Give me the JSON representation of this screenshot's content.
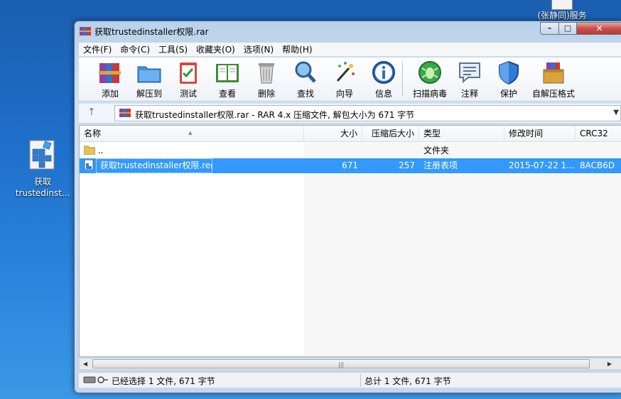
{
  "desktop": {
    "icon_label": "获取\ntrustedinst...",
    "icon_label_line1": "获取",
    "icon_label_line2": "trustedinst...",
    "top_right_label": "(张静同)服务"
  },
  "window": {
    "title": "获取trustedinstaller权限.rar",
    "controls": {
      "minimize": "–",
      "maximize": "□",
      "close": "✕"
    }
  },
  "menu": [
    "文件(F)",
    "命令(C)",
    "工具(S)",
    "收藏夹(O)",
    "选项(N)",
    "帮助(H)"
  ],
  "toolbar": [
    {
      "label": "添加",
      "icon": "books-icon"
    },
    {
      "label": "解压到",
      "icon": "folder-extract-icon"
    },
    {
      "label": "测试",
      "icon": "clipboard-check-icon"
    },
    {
      "label": "查看",
      "icon": "book-open-icon"
    },
    {
      "label": "删除",
      "icon": "trash-icon"
    },
    {
      "label": "查找",
      "icon": "magnifier-icon"
    },
    {
      "label": "向导",
      "icon": "wand-icon"
    },
    {
      "label": "信息",
      "icon": "info-icon"
    },
    {
      "label": "扫描病毒",
      "icon": "bug-icon"
    },
    {
      "label": "注释",
      "icon": "comment-icon"
    },
    {
      "label": "保护",
      "icon": "shield-icon"
    },
    {
      "label": "自解压格式",
      "icon": "sfx-box-icon"
    }
  ],
  "address": {
    "path": "获取trustedinstaller权限.rar - RAR 4.x 压缩文件, 解包大小为 671 字节"
  },
  "columns": [
    "名称",
    "大小",
    "压缩后大小",
    "类型",
    "修改时间",
    "CRC32"
  ],
  "files": [
    {
      "name": "..",
      "size": "",
      "packed": "",
      "type": "文件夹",
      "modified": "",
      "crc": "",
      "selected": false
    },
    {
      "name": "获取trustedinstaller权限.reg",
      "size": "671",
      "packed": "257",
      "type": "注册表项",
      "modified": "2015-07-22 1...",
      "crc": "8ACB6D",
      "selected": true
    }
  ],
  "status": {
    "left": "已经选择 1 文件, 671 字节",
    "right": "总计 1 文件, 671 字节"
  },
  "colors": {
    "selection": "#3399ff",
    "desktop": "#1f6ec9"
  }
}
